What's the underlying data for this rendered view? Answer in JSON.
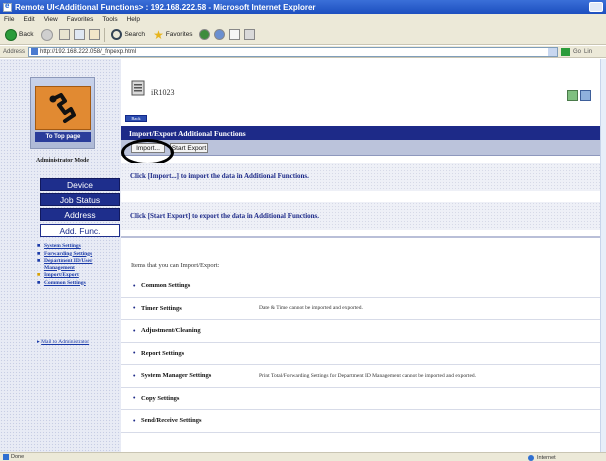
{
  "window": {
    "title": "Remote UI<Additional Functions> : 192.168.222.58 - Microsoft Internet Explorer"
  },
  "menubar": {
    "items": [
      "File",
      "Edit",
      "View",
      "Favorites",
      "Tools",
      "Help"
    ]
  },
  "toolbar": {
    "back_label": "Back",
    "search_label": "Search",
    "favorites_label": "Favorites"
  },
  "addressbar": {
    "label": "Address",
    "url": "http://192.168.222.058/_fnpexp.html",
    "go_label": "Go",
    "links_label": "Lin"
  },
  "sidebar": {
    "to_top_label": "To Top page",
    "admin_mode": "Administrator Mode",
    "nav": [
      "Device",
      "Job Status",
      "Address",
      "Add. Func."
    ],
    "active_nav": "Add. Func.",
    "sublinks": [
      {
        "label": "System Settings",
        "current": false
      },
      {
        "label": "Forwarding Settings",
        "current": false
      },
      {
        "label": "Department ID/User Management",
        "current": false
      },
      {
        "label": "Import/Export",
        "current": true
      },
      {
        "label": "Common Settings",
        "current": false
      }
    ],
    "mail_label": "Mail to Administrator"
  },
  "main": {
    "device_name": "iR1023",
    "back_label": "Back",
    "section_title": "Import/Export Additional Functions",
    "import_button": "Import...",
    "start_export_button": "Start Export",
    "import_desc": "Click [Import...] to import the data in Additional Functions.",
    "export_desc": "Click [Start Export] to export the data in Additional Functions.",
    "items_intro": "Items that you can Import/Export:",
    "items": [
      {
        "name": "Common Settings",
        "note": ""
      },
      {
        "name": "Timer Settings",
        "note": "Date & Time cannot be imported and exported."
      },
      {
        "name": "Adjustment/Cleaning",
        "note": ""
      },
      {
        "name": "Report Settings",
        "note": ""
      },
      {
        "name": "System Manager Settings",
        "note": "Print Total/Forwarding Settings for Department ID Management cannot be imported and exported."
      },
      {
        "name": "Copy Settings",
        "note": ""
      },
      {
        "name": "Send/Receive Settings",
        "note": ""
      }
    ]
  },
  "statusbar": {
    "status": "Done",
    "zone": "Internet"
  },
  "colors": {
    "title_bar": "#1d4fbf",
    "nav_blue": "#1e2e8c",
    "section_bar": "#1d2a88",
    "logo_orange": "#e18a32"
  }
}
